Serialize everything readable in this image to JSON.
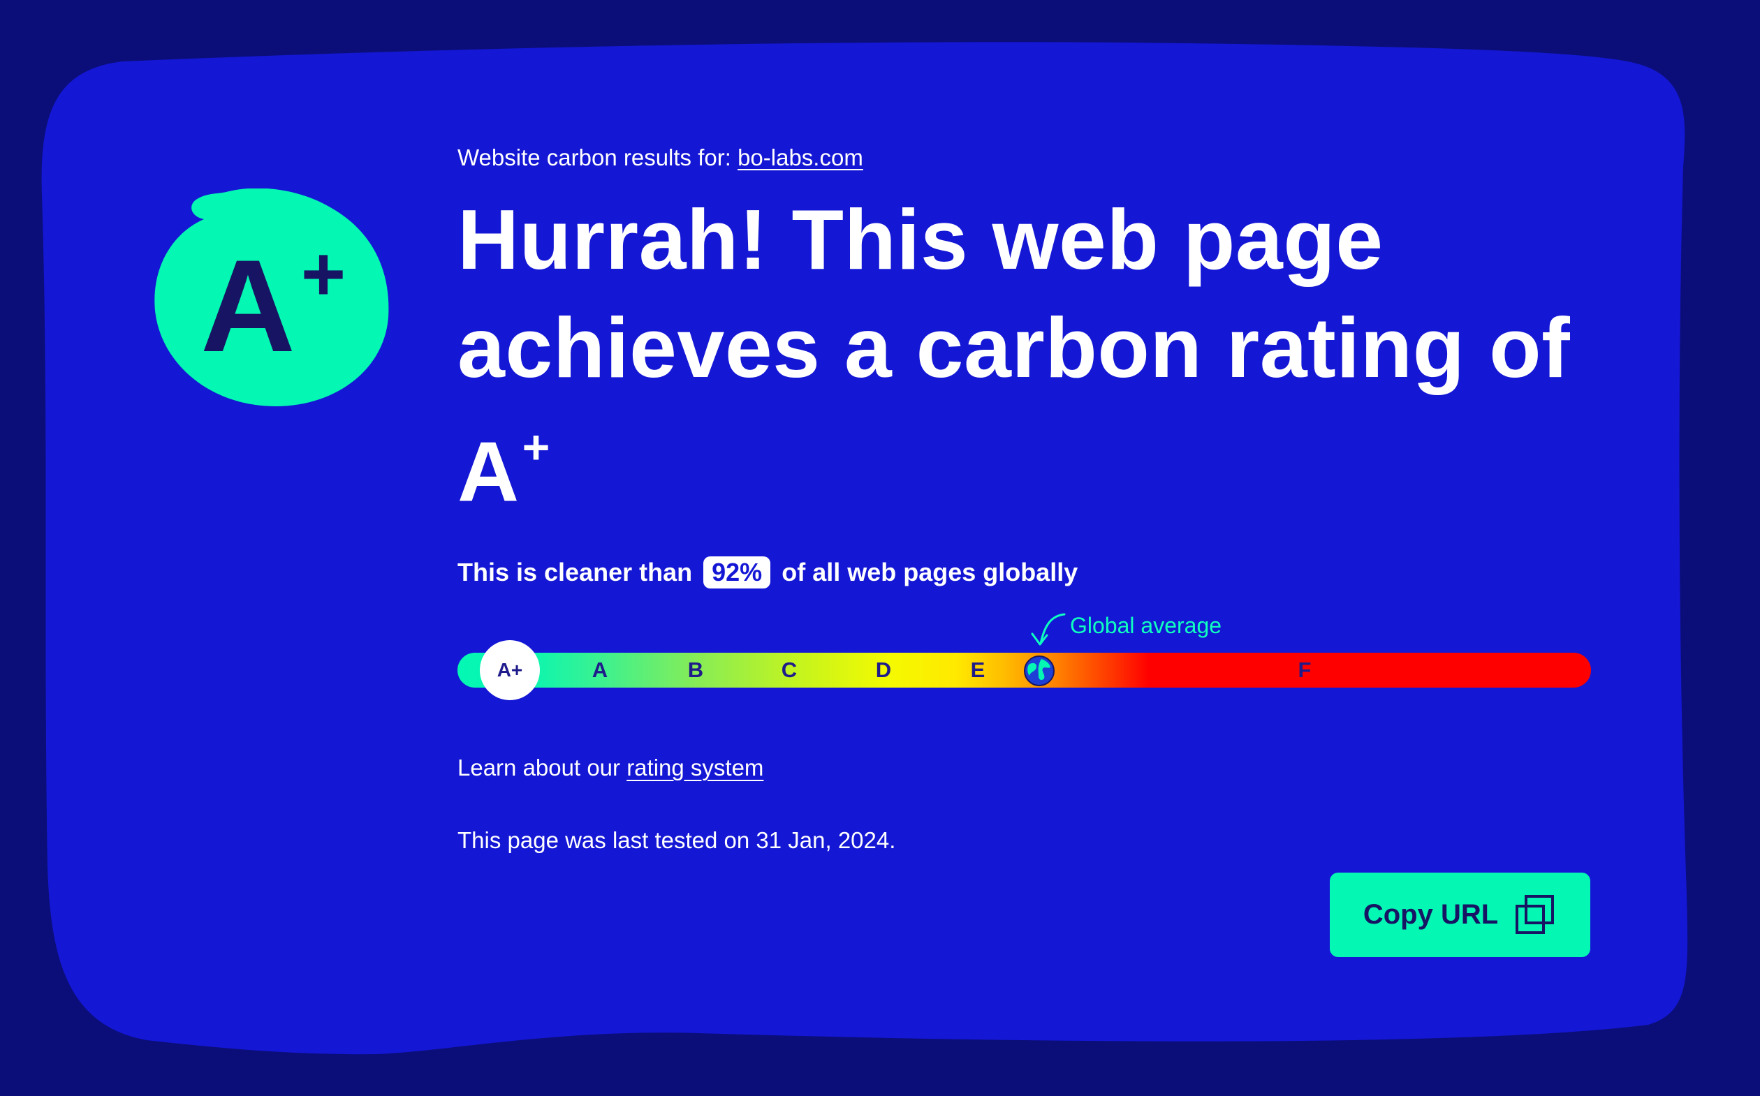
{
  "colors": {
    "page_background": "#0b0e78",
    "card_background": "#1417d4",
    "accent": "#04f7b3",
    "dark_text": "#171563"
  },
  "header": {
    "results_prefix": "Website carbon results for:",
    "site_link": "bo-labs.com"
  },
  "badge": {
    "letter": "A",
    "modifier": "+"
  },
  "headline": {
    "text": "Hurrah! This web page achieves a carbon rating of",
    "grade": "A",
    "grade_modifier": "+"
  },
  "cleaner": {
    "prefix": "This is cleaner than",
    "percent": "92%",
    "suffix": "of all web pages globally"
  },
  "scale": {
    "global_average_label": "Global average",
    "current_rating": "A+",
    "grades": [
      "A",
      "B",
      "C",
      "D",
      "E",
      "F"
    ],
    "globe_icon": "globe-icon"
  },
  "learn": {
    "prefix": "Learn about our",
    "link": "rating system"
  },
  "tested": {
    "text": "This page was last tested on 31 Jan, 2024."
  },
  "copy_button": {
    "label": "Copy URL",
    "icon": "copy-icon"
  }
}
